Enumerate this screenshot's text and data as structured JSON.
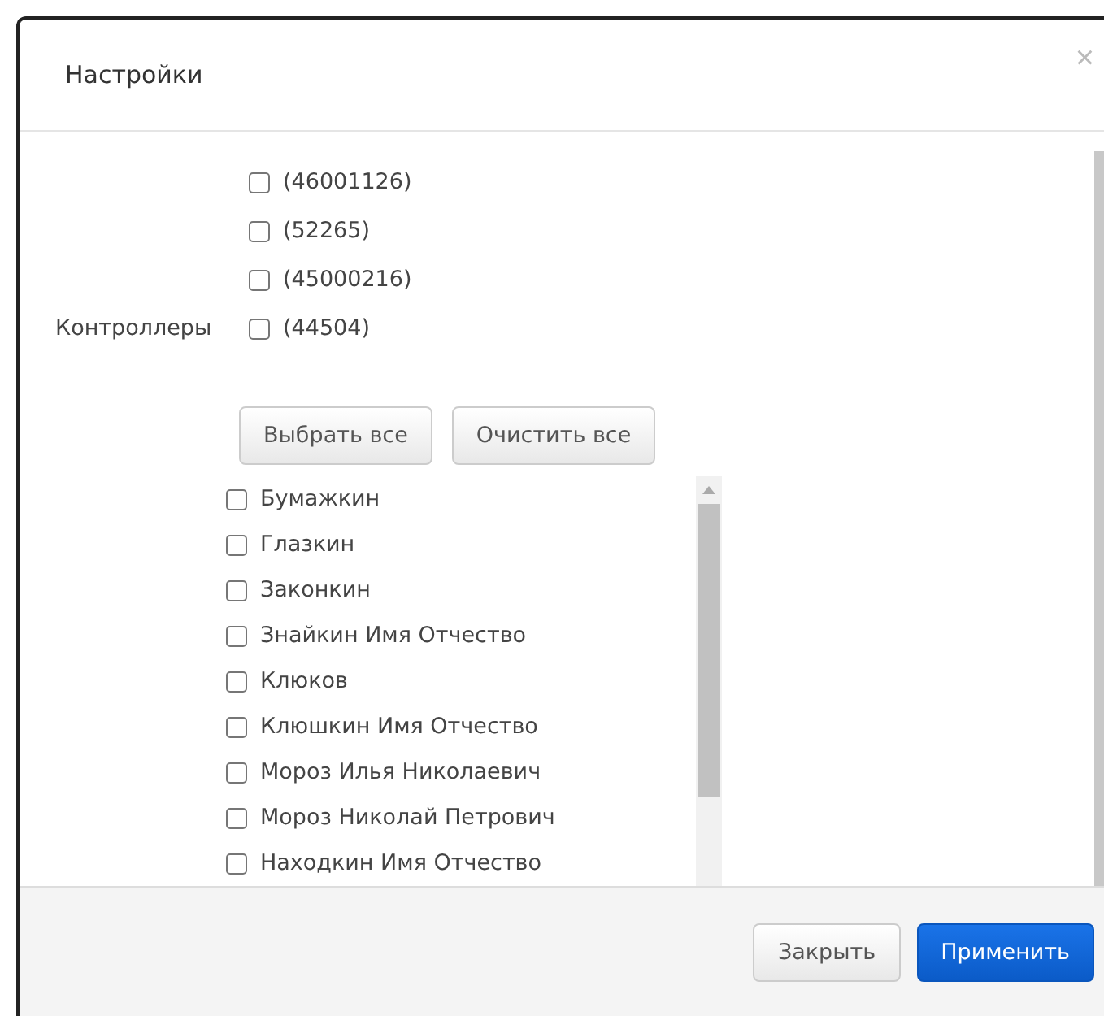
{
  "dialog": {
    "title": "Настройки",
    "close": "×"
  },
  "controllers": {
    "label": "Контроллеры",
    "items": [
      {
        "label": "(46001126)",
        "checked": false
      },
      {
        "label": "(52265)",
        "checked": false
      },
      {
        "label": "(45000216)",
        "checked": false
      },
      {
        "label": "(44504)",
        "checked": false
      }
    ]
  },
  "list_buttons": [
    "Выбрать все",
    "Очистить все"
  ],
  "people": [
    {
      "label": "Бумажкин",
      "checked": false
    },
    {
      "label": "Глазкин",
      "checked": false
    },
    {
      "label": "Законкин",
      "checked": false
    },
    {
      "label": "Знайкин Имя Отчество",
      "checked": false
    },
    {
      "label": "Клюков",
      "checked": false
    },
    {
      "label": "Клюшкин Имя Отчество",
      "checked": false
    },
    {
      "label": "Мороз Илья Николаевич",
      "checked": false
    },
    {
      "label": "Мороз Николай Петрович",
      "checked": false
    },
    {
      "label": "Находкин Имя Отчество",
      "checked": false
    }
  ],
  "footer": {
    "close": "Закрыть",
    "apply": "Применить"
  }
}
